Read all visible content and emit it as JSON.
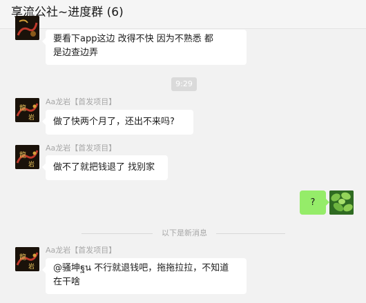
{
  "window": {
    "title": "享流公社~进度群 (6)"
  },
  "messages": [
    {
      "lines": [
        "要看下app这边   改得不快   因为不熟悉   都",
        "是边查边弄"
      ]
    },
    {
      "time": "9:29"
    },
    {
      "sender": "Aa龙岩【首发项目】",
      "text": "做了快两个月了，还出不来吗?"
    },
    {
      "sender": "Aa龙岩【首发项目】",
      "text": "做不了就把钱退了 找别家"
    },
    {
      "text": "?"
    },
    {
      "divider": "以下是新消息"
    },
    {
      "sender": "Aa龙岩【首发项目】",
      "lines": [
        "@骚坤ฐน 不行就退钱吧，拖拖拉拉，不知道",
        "在干啥"
      ]
    }
  ],
  "avatars": {
    "sender_avatar": "dragon-calligraphy-avatar",
    "self_avatar": "green-leaves-avatar"
  },
  "colors": {
    "self_bubble": "#95ec69",
    "other_bubble": "#ffffff",
    "background": "#f2f2f2"
  }
}
